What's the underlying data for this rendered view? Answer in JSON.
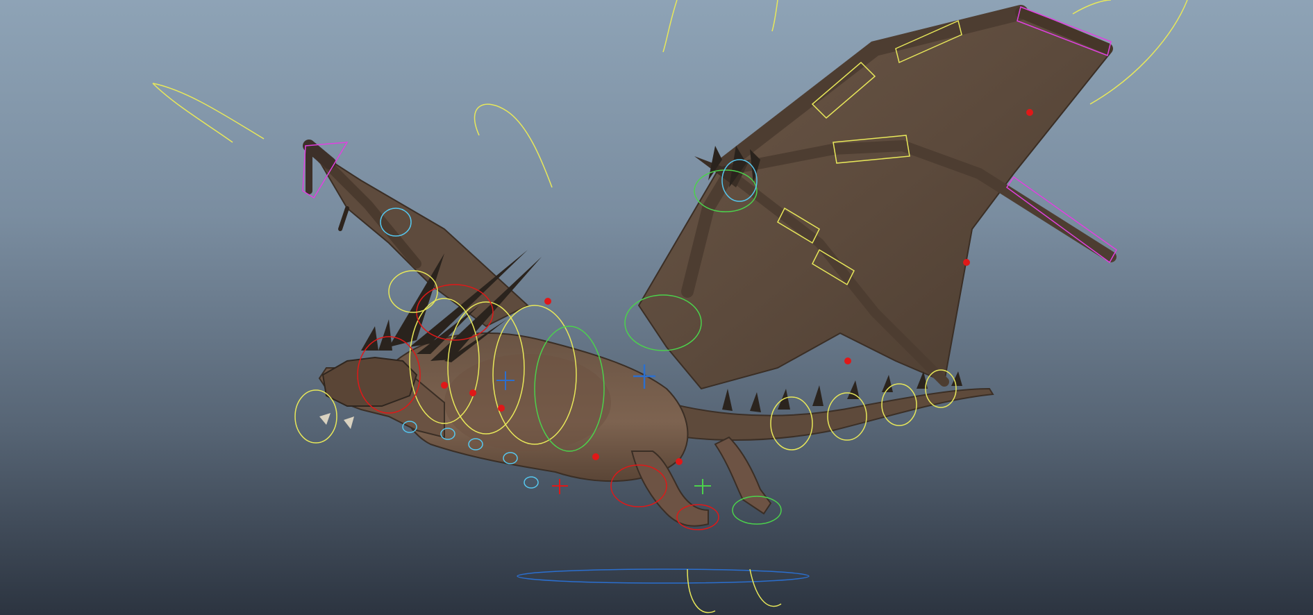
{
  "viewport": {
    "label": "",
    "background_top": "#8ea3b6",
    "background_bottom": "#2c3440"
  },
  "rig": {
    "character": "",
    "control_colors": {
      "fk": "#e8e85a",
      "ik": "#4cd24c",
      "root": "#2b6fcf",
      "pole": "#e040e0",
      "face": "#56c8f0",
      "locator": "#e01818",
      "spine": "#d8d840"
    },
    "icons": [
      "dragon-mesh",
      "wing-membrane",
      "rig-control-curves",
      "locator-dot",
      "ground-root-circle"
    ]
  }
}
